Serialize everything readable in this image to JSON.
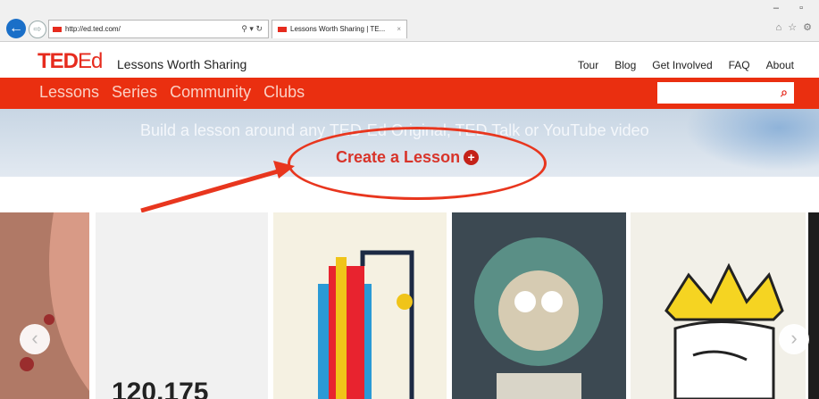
{
  "browser": {
    "url": "http://ed.ted.com/",
    "tab_title": "Lessons Worth Sharing | TE...",
    "tab_close": "×",
    "address_controls": "⚲ ▾ ↻",
    "window_controls": "–  ▫",
    "toolbar_icons": "⌂ ☆ ⚙",
    "back": "←",
    "forward": "⇨"
  },
  "site": {
    "logo_ted": "TED",
    "logo_ed": "Ed",
    "tagline": "Lessons Worth Sharing",
    "top_nav": [
      "Tour",
      "Blog",
      "Get Involved",
      "FAQ",
      "About"
    ],
    "main_nav": [
      "Lessons",
      "Series",
      "Community",
      "Clubs"
    ],
    "search_placeholder": "",
    "search_icon": "⌕"
  },
  "banner": {
    "text": "Build a lesson around any TED-Ed Original, TED Talk or YouTube video",
    "create_label": "Create a Lesson",
    "plus": "+"
  },
  "carousel": {
    "left_arrow": "‹",
    "right_arrow": "›",
    "partial_number": "120,175"
  },
  "colors": {
    "brand_red": "#e62b1e",
    "nav_red": "#ea2f10",
    "annotation": "#e8361e"
  }
}
